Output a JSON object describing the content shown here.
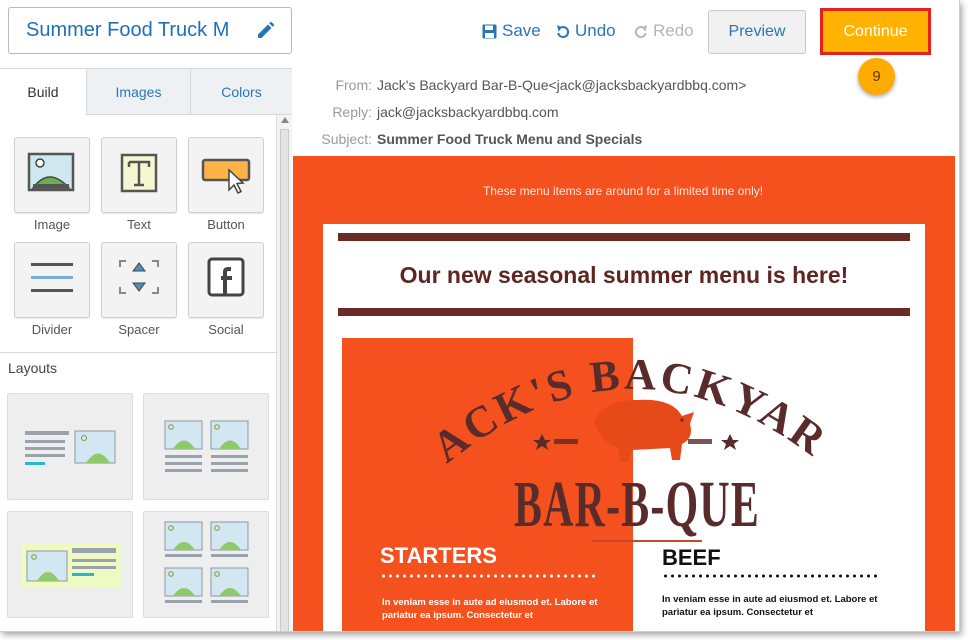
{
  "topbar": {
    "campaign_title": "Summer Food Truck M",
    "save_label": "Save",
    "undo_label": "Undo",
    "redo_label": "Redo",
    "preview_label": "Preview",
    "continue_label": "Continue",
    "step_badge": "9"
  },
  "left_panel": {
    "tabs": [
      {
        "label": "Build",
        "active": true
      },
      {
        "label": "Images",
        "active": false
      },
      {
        "label": "Colors",
        "active": false
      }
    ],
    "blocks": [
      {
        "label": "Image",
        "icon": "image-block-icon"
      },
      {
        "label": "Text",
        "icon": "text-block-icon"
      },
      {
        "label": "Button",
        "icon": "button-block-icon"
      },
      {
        "label": "Divider",
        "icon": "divider-block-icon"
      },
      {
        "label": "Spacer",
        "icon": "spacer-block-icon"
      },
      {
        "label": "Social",
        "icon": "facebook-icon"
      }
    ],
    "layouts_heading": "Layouts"
  },
  "email_header": {
    "from_label": "From:",
    "from_value": "Jack's Backyard Bar-B-Que<jack@jacksbackyardbbq.com>",
    "reply_label": "Reply:",
    "reply_value": "jack@jacksbackyardbbq.com",
    "subject_label": "Subject:",
    "subject_value": "Summer Food Truck Menu and Specials"
  },
  "email_body": {
    "preheader": "These menu items are around for a limited time only!",
    "headline": "Our new seasonal summer menu is here!",
    "logo_line1": "JACK'S BACKYARD",
    "logo_line2": "BAR-B-QUE",
    "starters_title": "STARTERS",
    "starters_text": "In veniam esse in aute ad eiusmod et. Labore et pariatur ea ipsum. Consectetur et",
    "beef_title": "BEEF",
    "beef_text": "In veniam esse in aute ad eiusmod et. Labore et pariatur ea ipsum. Consectetur et"
  },
  "colors": {
    "brand_orange": "#f4511e",
    "accent_blue": "#2a74b8",
    "continue_yellow": "#ffb300",
    "headline_brown": "#5f2621"
  }
}
